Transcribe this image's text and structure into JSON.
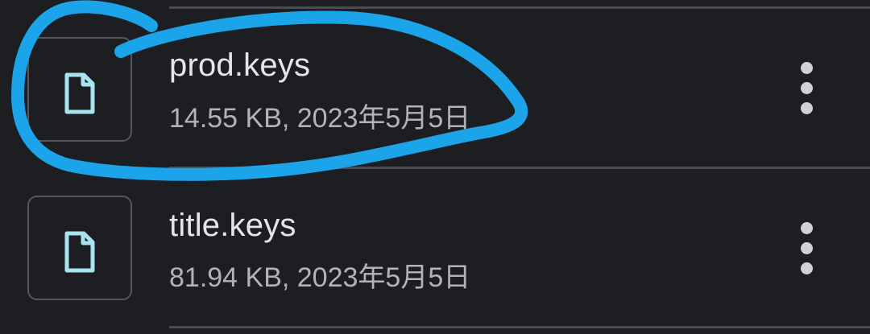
{
  "files": [
    {
      "name": "prod.keys",
      "meta": "14.55 KB, 2023年5月5日",
      "icon": "file-icon"
    },
    {
      "name": "title.keys",
      "meta": "81.94 KB, 2023年5月5日",
      "icon": "file-icon"
    }
  ],
  "more_icon": "more-vert-icon",
  "colors": {
    "background": "#1c1e22",
    "file_icon": "#a8e4ef",
    "annotation": "#1ca4ea"
  }
}
